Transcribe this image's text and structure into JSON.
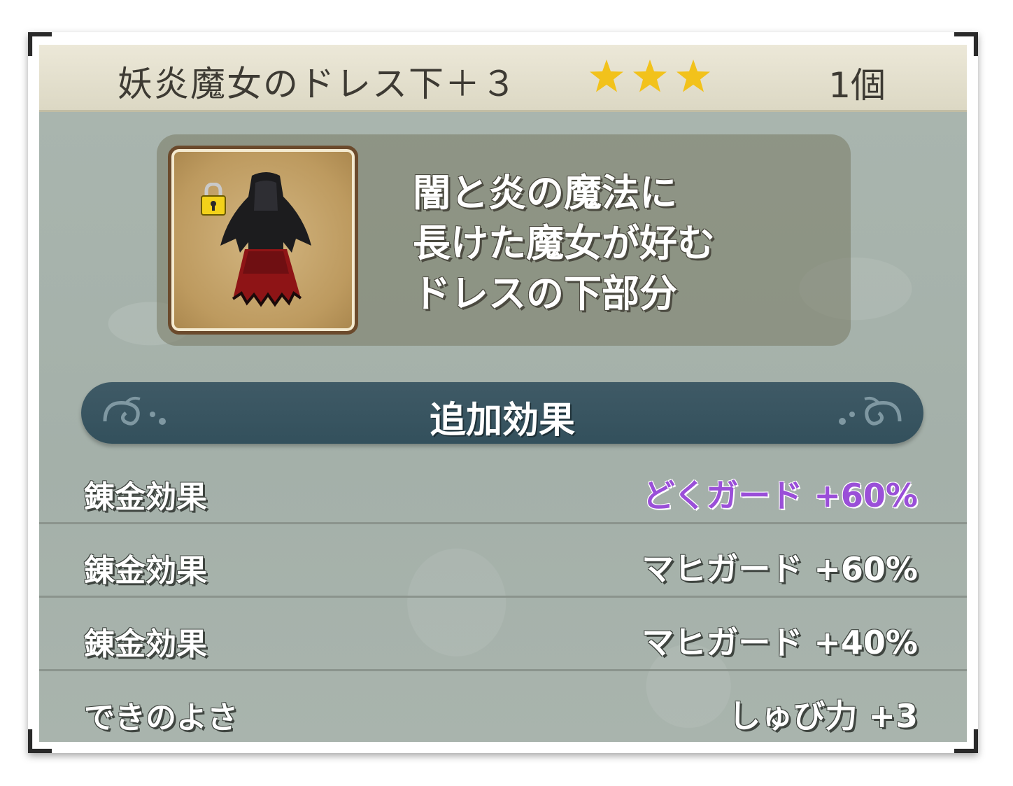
{
  "item": {
    "name": "妖炎魔女のドレス下＋３",
    "rarity_stars": 3,
    "count": "1個",
    "locked": true,
    "icon": "dress-bottom-icon",
    "description": [
      "闇と炎の魔法に",
      "長けた魔女が好む",
      "ドレスの下部分"
    ]
  },
  "section": {
    "title": "追加効果"
  },
  "effects": [
    {
      "label": "錬金効果",
      "value": "どくガード +60%",
      "color": "#9a4fd8"
    },
    {
      "label": "錬金効果",
      "value": "マヒガード +60%",
      "color": "#ffffff"
    },
    {
      "label": "錬金効果",
      "value": "マヒガード +40%",
      "color": "#ffffff"
    },
    {
      "label": "できのよさ",
      "value": "しゅび力 +3",
      "color": "#ffffff"
    }
  ],
  "colors": {
    "header_bg": "#e4e0cd",
    "panel_bg": "#a7b3ac",
    "banner_bg": "#3a5561",
    "star": "#f2c21b",
    "highlight_effect": "#9a4fd8"
  }
}
